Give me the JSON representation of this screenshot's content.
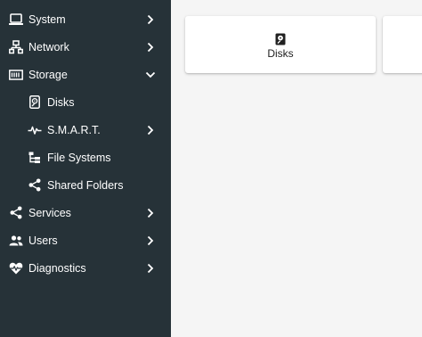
{
  "sidebar": {
    "items": [
      {
        "label": "System",
        "icon": "laptop-icon",
        "chevron": "right"
      },
      {
        "label": "Network",
        "icon": "network-icon",
        "chevron": "right"
      },
      {
        "label": "Storage",
        "icon": "storage-icon",
        "chevron": "down",
        "expanded": true
      },
      {
        "label": "Disks",
        "icon": "harddisk-icon",
        "sub": true
      },
      {
        "label": "S.M.A.R.T.",
        "icon": "pulse-icon",
        "sub": true,
        "chevron": "right"
      },
      {
        "label": "File Systems",
        "icon": "file-tree-icon",
        "sub": true
      },
      {
        "label": "Shared Folders",
        "icon": "share-icon",
        "sub": true
      },
      {
        "label": "Services",
        "icon": "share-icon",
        "chevron": "right"
      },
      {
        "label": "Users",
        "icon": "users-icon",
        "chevron": "right"
      },
      {
        "label": "Diagnostics",
        "icon": "heart-pulse-icon",
        "chevron": "right"
      }
    ]
  },
  "main": {
    "cards": [
      {
        "label": "Disks",
        "icon": "harddisk-icon"
      }
    ]
  },
  "colors": {
    "sidebar_bg": "#263238",
    "main_bg": "#f5f5f5",
    "card_bg": "#ffffff",
    "text_light": "#ffffff",
    "text_dark": "#212121"
  }
}
